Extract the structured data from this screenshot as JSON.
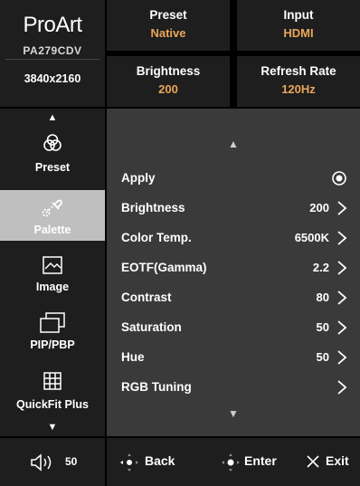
{
  "brand": {
    "logo": "ProArt",
    "model": "PA279CDV",
    "resolution": "3840x2160"
  },
  "status": [
    {
      "label": "Preset",
      "value": "Native"
    },
    {
      "label": "Input",
      "value": "HDMI"
    },
    {
      "label": "Brightness",
      "value": "200"
    },
    {
      "label": "Refresh Rate",
      "value": "120Hz"
    }
  ],
  "nav": {
    "items": [
      {
        "label": "Preset",
        "icon": "preset-icon"
      },
      {
        "label": "Palette",
        "icon": "palette-icon",
        "active": true
      },
      {
        "label": "Image",
        "icon": "image-icon"
      },
      {
        "label": "PIP/PBP",
        "icon": "pip-pbp-icon"
      },
      {
        "label": "QuickFit Plus",
        "icon": "quickfit-icon"
      }
    ]
  },
  "menu": {
    "rows": [
      {
        "label": "Apply",
        "value": "",
        "control": "radio-selected"
      },
      {
        "label": "Brightness",
        "value": "200",
        "control": "chevron"
      },
      {
        "label": "Color Temp.",
        "value": "6500K",
        "control": "chevron"
      },
      {
        "label": "EOTF(Gamma)",
        "value": "2.2",
        "control": "chevron"
      },
      {
        "label": "Contrast",
        "value": "80",
        "control": "chevron"
      },
      {
        "label": "Saturation",
        "value": "50",
        "control": "chevron"
      },
      {
        "label": "Hue",
        "value": "50",
        "control": "chevron"
      },
      {
        "label": "RGB Tuning",
        "value": "",
        "control": "chevron"
      }
    ]
  },
  "footer": {
    "volume": "50",
    "back": "Back",
    "enter": "Enter",
    "exit": "Exit"
  },
  "colors": {
    "accent": "#e8a65a",
    "panel": "#1e1e1e",
    "list_bg": "#3a3a3a",
    "active_nav": "#bfbfbf"
  }
}
